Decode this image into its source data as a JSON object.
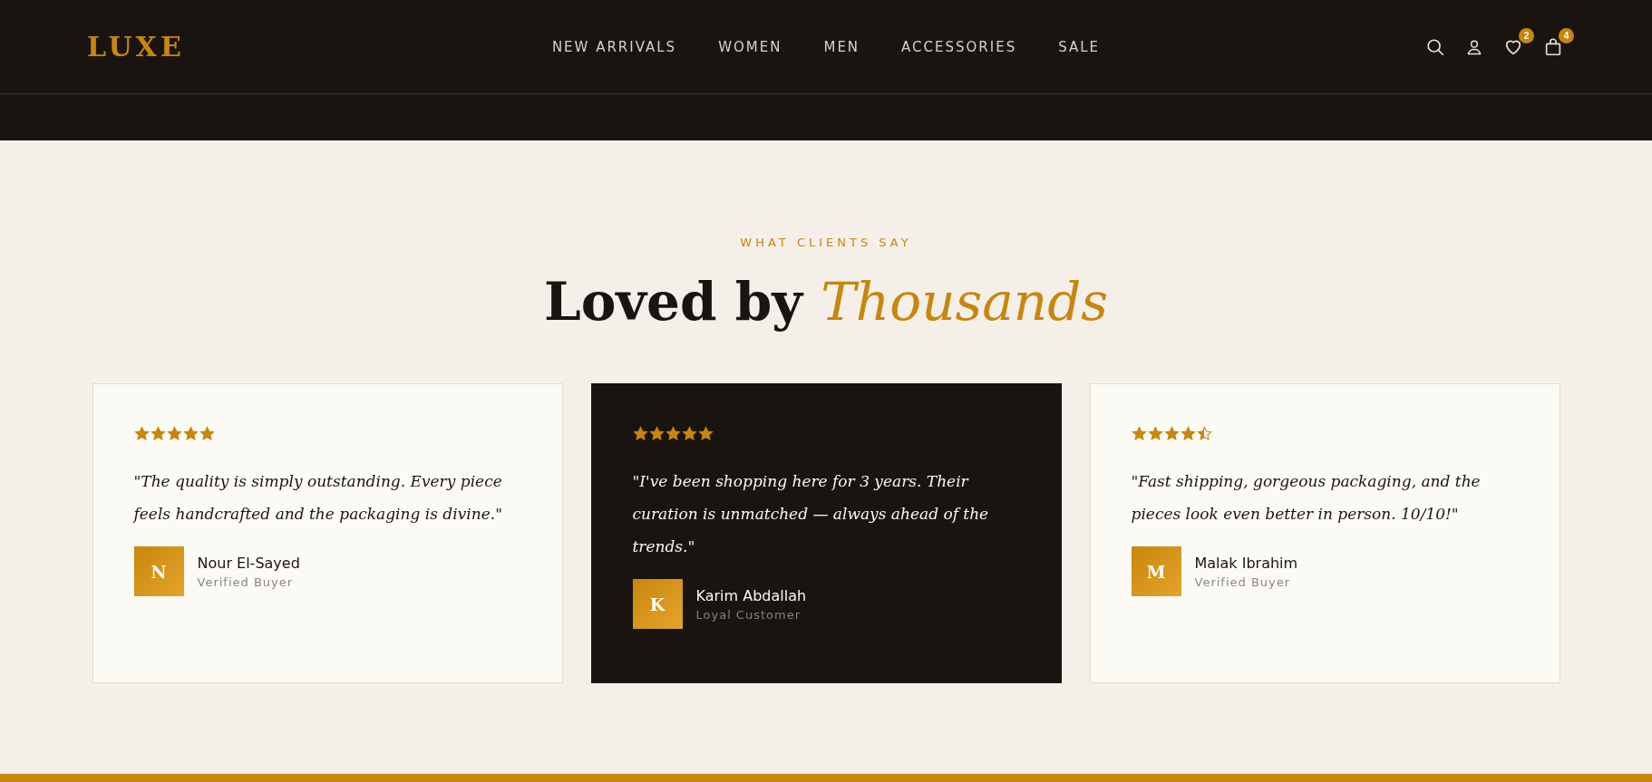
{
  "header": {
    "logo": "LUXE",
    "nav": [
      {
        "label": "NEW ARRIVALS"
      },
      {
        "label": "WOMEN"
      },
      {
        "label": "MEN"
      },
      {
        "label": "ACCESSORIES"
      },
      {
        "label": "SALE"
      }
    ],
    "icons": [
      {
        "kind": "search"
      },
      {
        "kind": "account"
      },
      {
        "kind": "wishlist",
        "badge": "2"
      },
      {
        "kind": "cart",
        "badge": "4"
      }
    ]
  },
  "section": {
    "eyebrow": "WHAT CLIENTS SAY",
    "title_plain": "Loved by",
    "title_accent": "Thousands"
  },
  "testimonials": [
    {
      "stars": 5,
      "highlighted": false,
      "quote": "\"The quality is simply outstanding. Every piece feels handcrafted and the packaging is divine.\"",
      "initial": "N",
      "name": "Nour El-Sayed",
      "role": "Verified Buyer"
    },
    {
      "stars": 5,
      "highlighted": true,
      "quote": "\"I've been shopping here for 3 years. Their curation is unmatched — always ahead of the trends.\"",
      "initial": "K",
      "name": "Karim Abdallah",
      "role": "Loyal Customer"
    },
    {
      "stars": 4.5,
      "highlighted": false,
      "quote": "\"Fast shipping, gorgeous packaging, and the pieces look even better in person. 10/10!\"",
      "initial": "M",
      "name": "Malak Ibrahim",
      "role": "Verified Buyer"
    }
  ]
}
